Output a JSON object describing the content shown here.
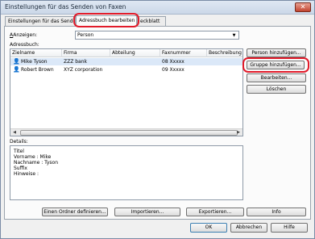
{
  "window": {
    "title": "Einstellungen für das Senden von Faxen",
    "close_glyph": "✕"
  },
  "tabs": [
    {
      "label": "Einstellungen für das Senden",
      "active": false
    },
    {
      "label": "Adressbuch bearbeiten",
      "active": true
    },
    {
      "label": "eckblatt",
      "active": false
    }
  ],
  "address": {
    "show_label": "Anzeigen:",
    "show_value": "Person",
    "book_label": "Adressbuch:",
    "columns": [
      "Zielname",
      "Firma",
      "Abteilung",
      "Faxnummer",
      "Beschreibung"
    ],
    "rows": [
      {
        "name": "Mike Tyson",
        "company": "ZZZ bank",
        "department": "",
        "fax": "08 Xxxxx",
        "desc": ""
      },
      {
        "name": "Robert Brown",
        "company": "XYZ corporation",
        "department": "",
        "fax": "09 Xxxxx",
        "desc": ""
      }
    ]
  },
  "side_buttons": {
    "add_person": "Person hinzufügen...",
    "add_group": "Gruppe hinzufügen...",
    "edit": "Bearbeiten...",
    "delete": "Löschen"
  },
  "details": {
    "label": "Details:",
    "lines": [
      "Titel",
      "Vorname     : Mike",
      "Nachname  : Tyson",
      "Suffix",
      "Hinweise    :"
    ]
  },
  "bottom_buttons": {
    "define_folder": "Einen Ordner definieren...",
    "import": "Importieren...",
    "export": "Exportieren...",
    "info": "Info"
  },
  "dialog_buttons": {
    "ok": "OK",
    "cancel": "Abbrechen",
    "help": "Hilfe"
  },
  "icons": {
    "person": "person-icon"
  },
  "colors": {
    "highlight": "#e11b2a",
    "selection": "#dbe8f8"
  }
}
